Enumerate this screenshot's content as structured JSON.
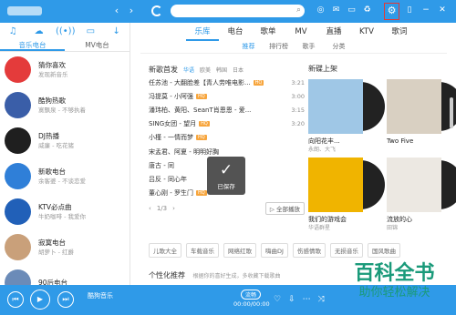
{
  "sidebar": {
    "tabs": [
      "音乐电台",
      "MV电台"
    ],
    "radios": [
      {
        "title": "猜你喜欢",
        "sub": "发现新音乐",
        "color": "#e43b3b"
      },
      {
        "title": "酷狗热歌",
        "sub": "寞飘泉 - 不够执着",
        "color": "#3a5ea8"
      },
      {
        "title": "DJ热播",
        "sub": "威廉 - 吃花猪",
        "color": "#1f1f1f"
      },
      {
        "title": "新歌电台",
        "sub": "余客婆 - 不谈恋爱",
        "color": "#2f7fd8"
      },
      {
        "title": "KTV必点曲",
        "sub": "牛奶咖啡 - 我爱你",
        "color": "#2160b8"
      },
      {
        "title": "寂寞电台",
        "sub": "胡萝卜 - 红爵",
        "color": "#c9a07a"
      },
      {
        "title": "90后电台",
        "sub": "",
        "color": "#6b8bb8"
      }
    ]
  },
  "main": {
    "tabs": [
      "乐库",
      "电台",
      "歌单",
      "MV",
      "直播",
      "KTV",
      "歌词"
    ],
    "subtabs": [
      "推荐",
      "排行榜",
      "歌手",
      "分类"
    ],
    "new_songs": {
      "title": "新歌首发",
      "filters": [
        "华语",
        "欧美",
        "韩国",
        "日本"
      ],
      "songs": [
        {
          "name": "任苏池 - 大翻脸差【青人劳唯电影...",
          "dur": "3:21",
          "hq": true
        },
        {
          "name": "冯提莫 - 小阿强",
          "dur": "3:00",
          "hq": true
        },
        {
          "name": "潘玮柏、黄阳、SeanT肖恩恩 - 爱...",
          "dur": "3:15",
          "hq": false
        },
        {
          "name": "SING女团 - 望月",
          "dur": "3:20",
          "hq": true
        },
        {
          "name": "小槿 - 一情而梦",
          "dur": "",
          "hq": true
        },
        {
          "name": "宋孟君、阿夏 - 明明好胸",
          "dur": "",
          "hq": false
        },
        {
          "name": "唐古 - 同",
          "dur": "",
          "hq": false
        },
        {
          "name": "吕反 - 同心年",
          "dur": "",
          "hq": false
        },
        {
          "name": "董心刚 - 罗生门",
          "dur": "",
          "hq": true
        }
      ],
      "pager": {
        "prev": "‹",
        "page": "1/3",
        "next": "›"
      },
      "play_all": "▷ 全部播放"
    },
    "toast": {
      "label": "已保存"
    },
    "new_albums": {
      "title": "新碟上架",
      "albums": [
        {
          "title": "向阳花丰...",
          "sub": "永朗、大飞",
          "art": "#9fc7e6"
        },
        {
          "title": "Two Five",
          "sub": "",
          "art": "#d9d0c2"
        },
        {
          "title": "我们的游戏会",
          "sub": "华语群星",
          "art": "#f0b400"
        },
        {
          "title": "流放的心",
          "sub": "田锦",
          "art": "#ece8e2"
        }
      ]
    },
    "tags": [
      "儿歌大全",
      "车载音乐",
      "网络红歌",
      "嗨曲DJ",
      "伤感情歌",
      "无损音乐",
      "国风歌曲"
    ],
    "personal": {
      "title": "个性化推荐",
      "sub": "根据你的喜好生成，多收藏下载歌曲"
    }
  },
  "player": {
    "title": "酷狗音乐",
    "mode": "流畅",
    "time": "00:00/00:00"
  },
  "watermark": {
    "line1": "百科全书",
    "line2": "助你轻松解决"
  }
}
